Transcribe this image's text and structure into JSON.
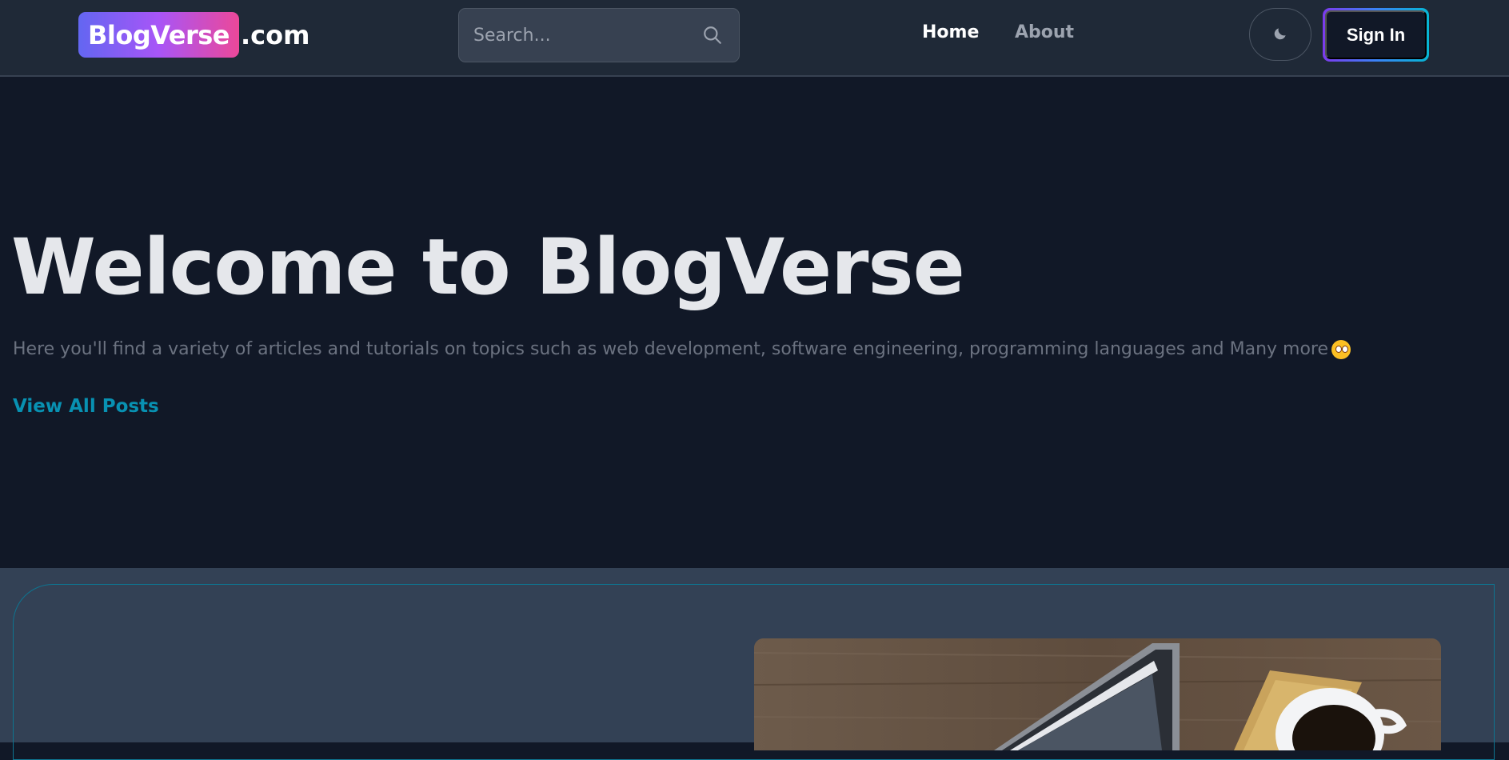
{
  "header": {
    "logo_name": "BlogVerse",
    "logo_suffix": ".com",
    "search_placeholder": "Search...",
    "nav": [
      {
        "label": "Home",
        "active": true
      },
      {
        "label": "About",
        "active": false
      }
    ],
    "theme_icon": "moon-icon",
    "signin_label": "Sign In"
  },
  "hero": {
    "title": "Welcome to BlogVerse",
    "subtitle": "Here you'll find a variety of articles and tutorials on topics such as web development, software engineering, programming languages and Many more",
    "emoji_icon": "rolling-eyes-emoji-icon",
    "cta_label": "View All Posts"
  },
  "colors": {
    "background": "#111827",
    "header_bg": "#1f2937",
    "accent": "#0891b2",
    "section_bg": "#334155"
  }
}
